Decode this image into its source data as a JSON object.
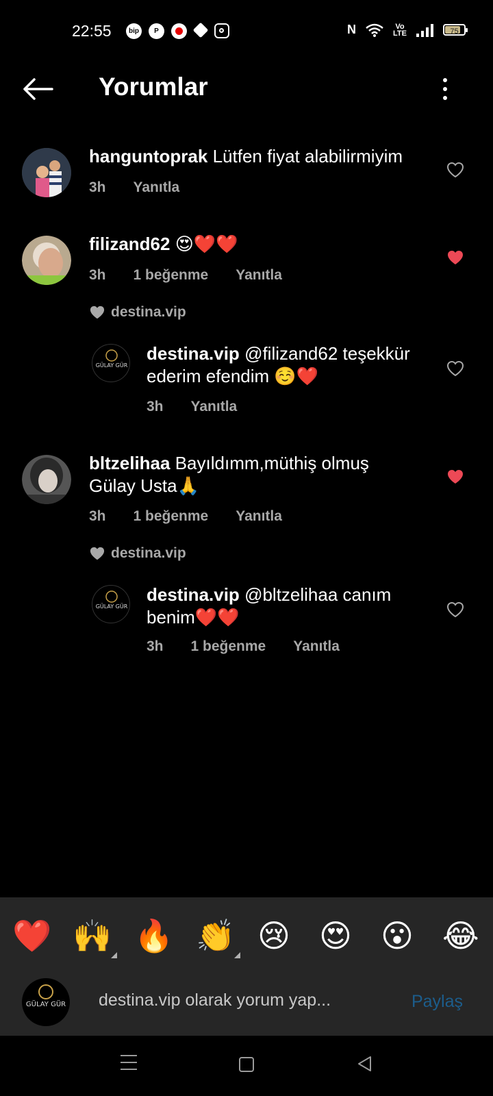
{
  "status_bar": {
    "time": "22:55",
    "left_icons": [
      "bip-icon",
      "pinterest-icon",
      "vodafone-icon",
      "box-icon",
      "instagram-icon"
    ],
    "bip_label": "bip",
    "pinterest_label": "P",
    "right_icons": [
      "nfc-icon",
      "wifi-icon",
      "volte-icon",
      "signal-icon",
      "battery-icon"
    ],
    "nfc_label": "N",
    "volte_label": "Vo LTE",
    "battery": "75"
  },
  "header": {
    "title": "Yorumlar"
  },
  "comments": [
    {
      "username": "hanguntoprak",
      "text": "Lütfen fiyat alabilirmiyim",
      "time": "3h",
      "likes": "",
      "reply_label": "Yanıtla",
      "liked": false
    },
    {
      "username": "filizand62",
      "text": "😍❤️❤️",
      "time": "3h",
      "likes": "1 beğenme",
      "reply_label": "Yanıtla",
      "liked": true,
      "liked_by": "destina.vip",
      "reply": {
        "username": "destina.vip",
        "text_line1": "@filizand62 teşekkür",
        "text_line2": "ederim efendim ☺️❤️",
        "time": "3h",
        "likes": "",
        "reply_label": "Yanıtla",
        "liked": false
      }
    },
    {
      "username": "bltzelihaa",
      "text_line1": "Bayıldımm,müthiş olmuş",
      "text_line2": "Gülay Usta🙏",
      "time": "3h",
      "likes": "1 beğenme",
      "reply_label": "Yanıtla",
      "liked": true,
      "liked_by": "destina.vip",
      "reply": {
        "username": "destina.vip",
        "text_line1": "@bltzelihaa canım",
        "text_line2": "benim❤️❤️",
        "time": "3h",
        "likes": "1 beğenme",
        "reply_label": "Yanıtla",
        "liked": false
      }
    }
  ],
  "logo_text": "GÜLAY GÜR",
  "emoji_bar": [
    "❤️",
    "🙌",
    "🔥",
    "👏",
    "😢",
    "😍",
    "😮",
    "😂"
  ],
  "composer": {
    "placeholder": "destina.vip olarak yorum yap...",
    "share_label": "Paylaş"
  },
  "colors": {
    "background": "#000000",
    "secondary_text": "#a8a8a8",
    "liked_heart": "#ed4956",
    "share_disabled": "#1c5d8c",
    "panel": "#262626"
  }
}
